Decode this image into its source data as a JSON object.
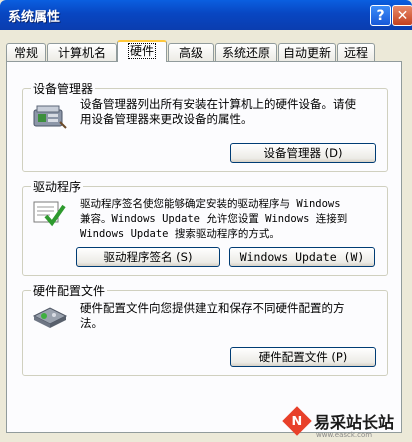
{
  "window": {
    "title": "系统属性",
    "help_label": "?",
    "close_label": "✕"
  },
  "tabs": [
    {
      "label": "常规"
    },
    {
      "label": "计算机名"
    },
    {
      "label": "硬件"
    },
    {
      "label": "高级"
    },
    {
      "label": "系统还原"
    },
    {
      "label": "自动更新"
    },
    {
      "label": "远程"
    }
  ],
  "active_tab": "硬件",
  "device_manager": {
    "legend": "设备管理器",
    "desc_line1": "设备管理器列出所有安装在计算机上的硬件设备。请使",
    "desc_line2": "用设备管理器来更改设备的属性。",
    "button": "设备管理器 (D)",
    "icon": "device-manager-icon"
  },
  "drivers": {
    "legend": "驱动程序",
    "desc_line1": "驱动程序签名使您能够确定安装的驱动程序与 Windows",
    "desc_line2": "兼容。Windows Update 允许您设置 Windows 连接到",
    "desc_line3": "Windows Update 搜索驱动程序的方式。",
    "button_signing": "驱动程序签名 (S)",
    "button_update": "Windows Update (W)",
    "icon": "driver-signing-icon"
  },
  "hardware_profiles": {
    "legend": "硬件配置文件",
    "desc_line1": "硬件配置文件向您提供建立和保存不同硬件配置的方",
    "desc_line2": "法。",
    "button": "硬件配置文件 (P)",
    "icon": "hardware-profile-icon"
  },
  "watermark": {
    "logo_char": "N",
    "text": "易采站长站",
    "url": "www.easck.com"
  },
  "colors": {
    "titlebar": "#0A4FD0",
    "panel": "#FCFCFE",
    "dialog_bg": "#ECE9D8",
    "tab_highlight": "#FFC83C"
  }
}
